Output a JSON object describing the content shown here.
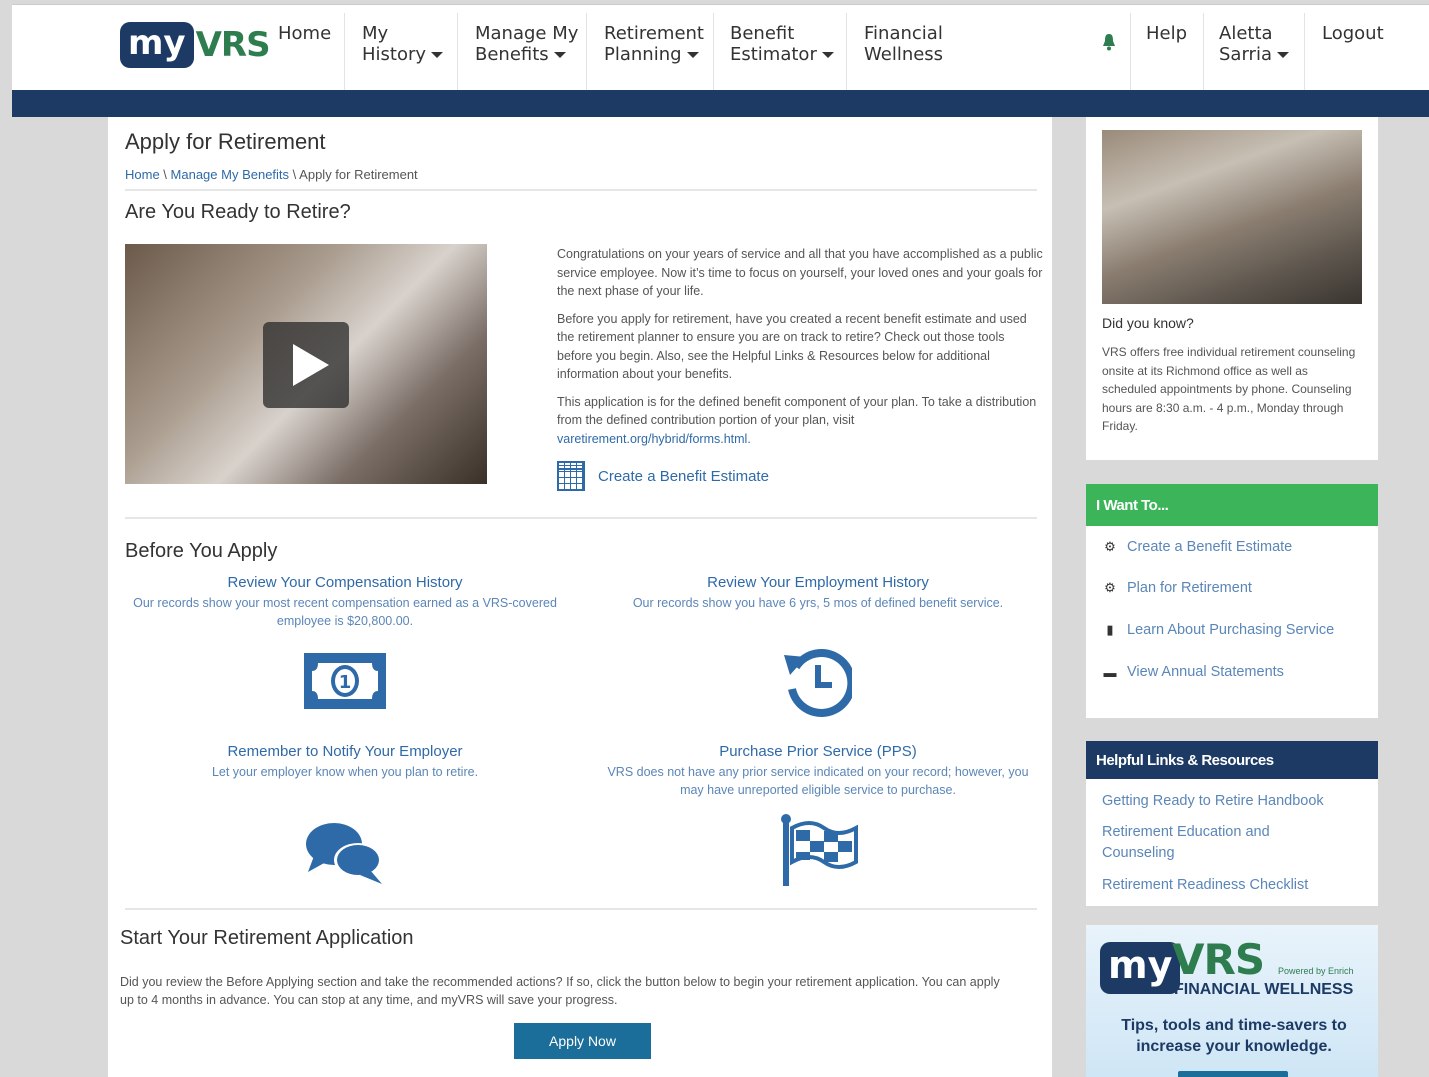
{
  "header": {
    "logo_my": "my",
    "logo_vrs": "VRS",
    "nav": {
      "home": "Home",
      "my_history_1": "My",
      "my_history_2": "History",
      "manage_1": "Manage My",
      "manage_2": "Benefits",
      "retirement_1": "Retirement",
      "retirement_2": "Planning",
      "estimator_1": "Benefit",
      "estimator_2": "Estimator",
      "wellness_1": "Financial",
      "wellness_2": "Wellness",
      "help": "Help",
      "user_1": "Aletta",
      "user_2": "Sarria",
      "logout": "Logout"
    }
  },
  "main": {
    "title": "Apply for Retirement",
    "breadcrumb": {
      "home": "Home",
      "manage": "Manage My Benefits",
      "current": "Apply for Retirement"
    },
    "ready_heading": "Are You Ready to Retire?",
    "intro_p1": "Congratulations on your years of service and all that you have accomplished as a public service employee. Now it’s time to focus on yourself, your loved ones and your goals for the next phase of your life.",
    "intro_p2": "Before you apply for retirement, have you created a recent benefit estimate and used the retirement planner to ensure you are on track to retire? Check out those tools before you begin. Also, see the Helpful Links & Resources below for additional information about your benefits.",
    "intro_p3": "This application is for the defined benefit component of your plan. To take a distribution from the defined contribution portion of your plan, visit",
    "intro_link": "varetirement.org/hybrid/forms.html.",
    "create_estimate": "Create a Benefit Estimate",
    "before_heading": "Before You Apply",
    "cards": {
      "comp_title": "Review Your Compensation History",
      "comp_desc": "Our records show your most recent compensation earned as a VRS-covered employee is $20,800.00.",
      "emp_title": "Review Your Employment History",
      "emp_desc": "Our records show you have 6 yrs, 5 mos of defined benefit service.",
      "notify_title": "Remember to Notify Your Employer",
      "notify_desc": "Let your employer know when you plan to retire.",
      "pps_title": "Purchase Prior Service (PPS)",
      "pps_desc": "VRS does not have any prior service indicated on your record; however, you may have unreported eligible service to purchase."
    },
    "start_heading": "Start Your Retirement Application",
    "start_text": "Did you review the Before Applying section and take the recommended actions? If so, click the button below to begin your retirement application. You can apply up to 4 months in advance. You can stop at any time, and myVRS will save your progress.",
    "apply_button": "Apply Now"
  },
  "sidebar": {
    "dyk_title": "Did you know?",
    "dyk_text": "VRS offers free individual retirement counseling onsite at its Richmond office as well as scheduled appointments by phone. Counseling hours are 8:30 a.m. - 4 p.m., Monday through Friday.",
    "want_title": "I Want To...",
    "want_items": [
      "Create a Benefit Estimate",
      "Plan for Retirement",
      "Learn About Purchasing Service",
      "View Annual Statements"
    ],
    "links_title": "Helpful Links & Resources",
    "links": [
      "Getting Ready to Retire Handbook",
      "Retirement Education and Counseling",
      "Retirement Readiness Checklist"
    ],
    "promo_my": "my",
    "promo_vrs": "VRS",
    "promo_powered": "Powered by Enrich",
    "promo_fw": "FINANCIAL WELLNESS",
    "promo_tag": "Tips, tools and time-savers to increase your knowledge."
  },
  "colors": {
    "navy": "#1c3a64",
    "green": "#3cb55a",
    "link": "#2f6aa8",
    "button": "#1b6e99"
  }
}
